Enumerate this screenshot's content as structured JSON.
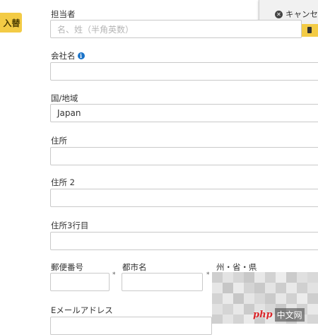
{
  "side_button": {
    "label": "入替"
  },
  "cancel_button": {
    "label": "キャンセ"
  },
  "form": {
    "assignee": {
      "label": "担当者",
      "placeholder": "名、姓（半角英数）"
    },
    "company": {
      "label": "会社名"
    },
    "country": {
      "label": "国/地域",
      "value": "Japan"
    },
    "address1": {
      "label": "住所"
    },
    "address2": {
      "label": "住所 2"
    },
    "address3": {
      "label": "住所3行目"
    },
    "postal_code": {
      "label": "郵便番号",
      "required_mark": "*"
    },
    "city": {
      "label": "都市名",
      "required_mark": "*"
    },
    "state": {
      "label": "州・省・県"
    },
    "email": {
      "label": "Eメールアドレス"
    }
  },
  "watermark": {
    "prefix": "php",
    "suffix": "中文网"
  },
  "colors": {
    "accent": "#f3cb45",
    "info": "#1a73c8",
    "border": "#c9c9c9"
  }
}
